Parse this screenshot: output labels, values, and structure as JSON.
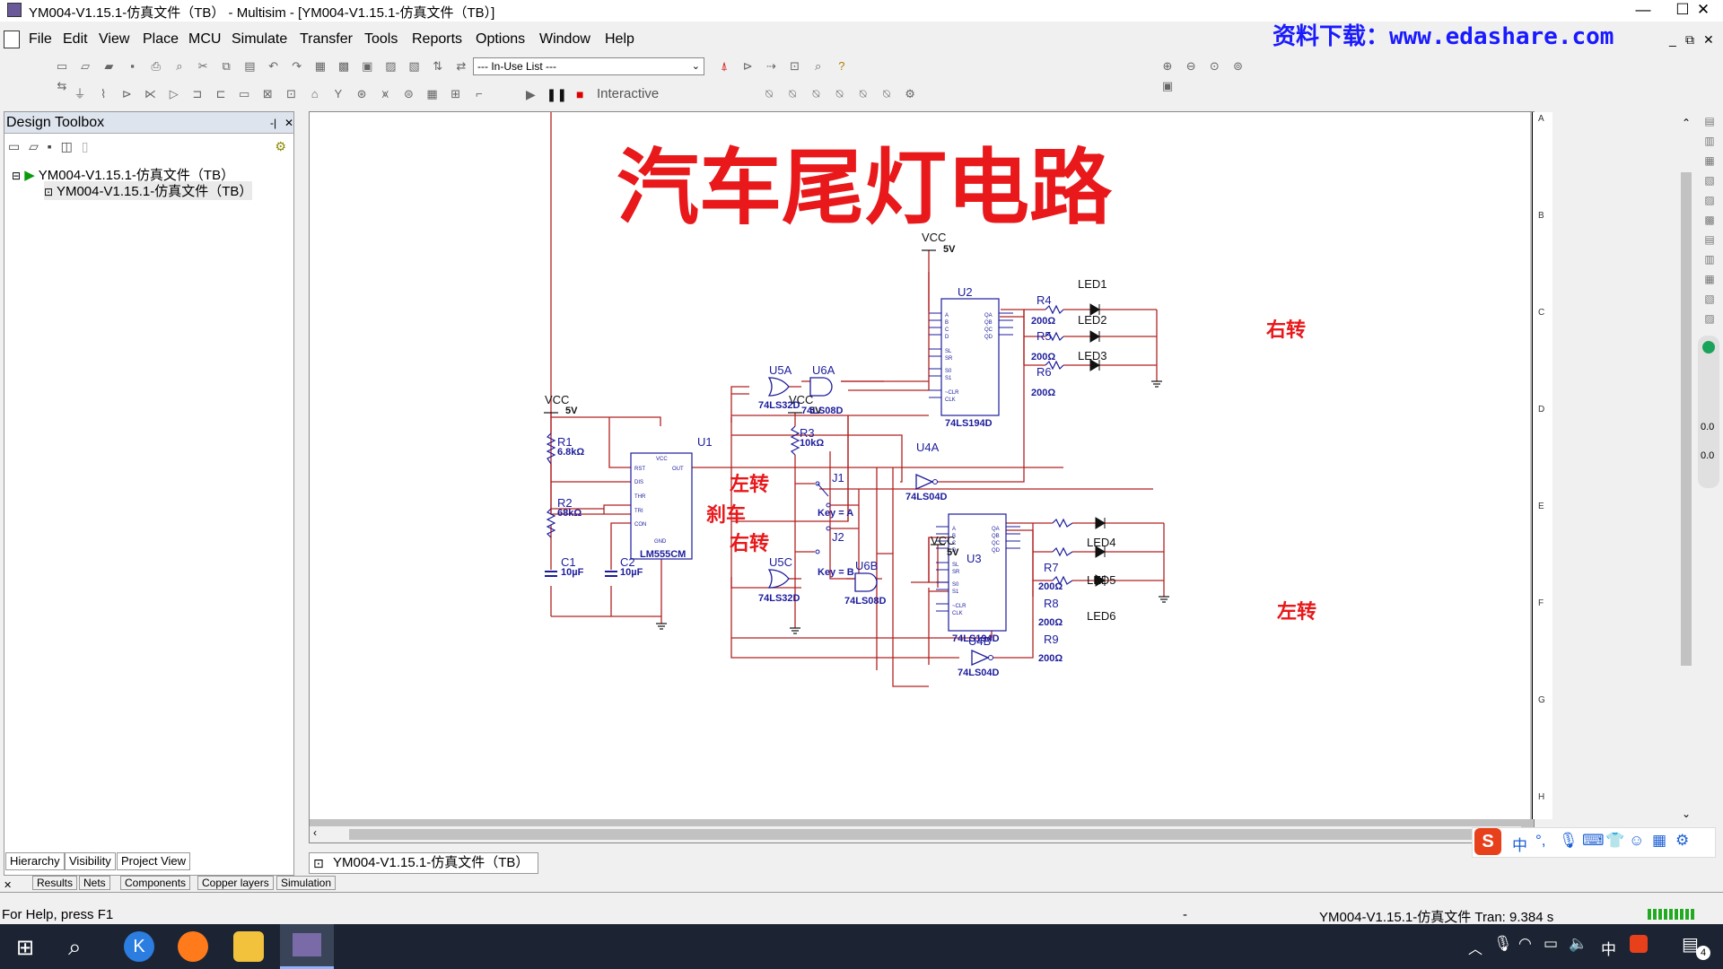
{
  "window": {
    "title": "YM004-V1.15.1-仿真文件（TB）  - Multisim - [YM004-V1.15.1-仿真文件（TB）]",
    "controls": [
      "—",
      "☐",
      "✕"
    ],
    "watermark": "资料下载：www.edashare.com"
  },
  "menu": [
    "File",
    "Edit",
    "View",
    "Place",
    "MCU",
    "Simulate",
    "Transfer",
    "Tools",
    "Reports",
    "Options",
    "Window",
    "Help"
  ],
  "mdi_controls": [
    "_",
    "⧉",
    "✕"
  ],
  "toolbar": {
    "inuse_list": "--- In-Use List ---",
    "interactive_label": "Interactive"
  },
  "toolbox": {
    "title": "Design Toolbox",
    "tree_root": "YM004-V1.15.1-仿真文件（TB）",
    "tree_child": "YM004-V1.15.1-仿真文件（TB）",
    "tabs": [
      "Hierarchy",
      "Visibility",
      "Project View"
    ]
  },
  "schematic": {
    "title": "汽车尾灯电路",
    "border_letters": [
      "A",
      "B",
      "C",
      "D",
      "E",
      "F",
      "G",
      "H"
    ],
    "labels": {
      "vcc": "VCC",
      "five_v": "5V",
      "u1": "U1",
      "u1_part": "LM555CM",
      "r1": "R1",
      "r1_val": "6.8kΩ",
      "r2": "R2",
      "r2_val": "68kΩ",
      "c1": "C1",
      "c1_val": "10µF",
      "c2": "C2",
      "c2_val": "10µF",
      "r3": "R3",
      "r3_val": "10kΩ",
      "j1": "J1",
      "j1_key": "Key = A",
      "j2": "J2",
      "j2_key": "Key = B",
      "left_turn": "左转",
      "brake": "刹车",
      "right_turn": "右转",
      "u5a": "U5A",
      "u5c": "U5C",
      "or_part": "74LS32D",
      "u6a": "U6A",
      "u6b": "U6B",
      "and_part": "74LS08D",
      "u4a": "U4A",
      "u4b": "U4B",
      "inv_part": "74LS04D",
      "u2": "U2",
      "u3": "U3",
      "reg_part": "74LS194D",
      "r4": "R4",
      "r5": "R5",
      "r6": "R6",
      "r7": "R7",
      "r8": "R8",
      "r9": "R9",
      "res_val": "200Ω",
      "led1": "LED1",
      "led2": "LED2",
      "led3": "LED3",
      "led4": "LED4",
      "led5": "LED5",
      "led6": "LED6",
      "right_out": "右转",
      "left_out": "左转",
      "p555": [
        "RST",
        "DIS",
        "THR",
        "TRI",
        "CON",
        "GND",
        "VCC",
        "OUT"
      ],
      "p194": [
        "A",
        "B",
        "C",
        "D",
        "SL",
        "SR",
        "S0",
        "S1",
        "~CLR",
        "CLK",
        "QA",
        "QB",
        "QC",
        "QD"
      ]
    }
  },
  "sheet_tab": "YM004-V1.15.1-仿真文件（TB）",
  "bottom_tabs": [
    "Results",
    "Nets",
    "Components",
    "Copper layers",
    "Simulation"
  ],
  "status": {
    "help": "For Help, press F1",
    "dash": "-",
    "tran": "YM004-V1.15.1-仿真文件 Tran: 9.384 s"
  },
  "side_readouts": [
    "0.0",
    "0.0"
  ],
  "ime": {
    "lang": "中"
  },
  "taskbar": {
    "tray_lang": "中",
    "notif_count": "4"
  },
  "colors": {
    "wire": "#b22222",
    "part": "#1c1c9c",
    "title": "#e8181b",
    "label_red": "#e8181b"
  }
}
